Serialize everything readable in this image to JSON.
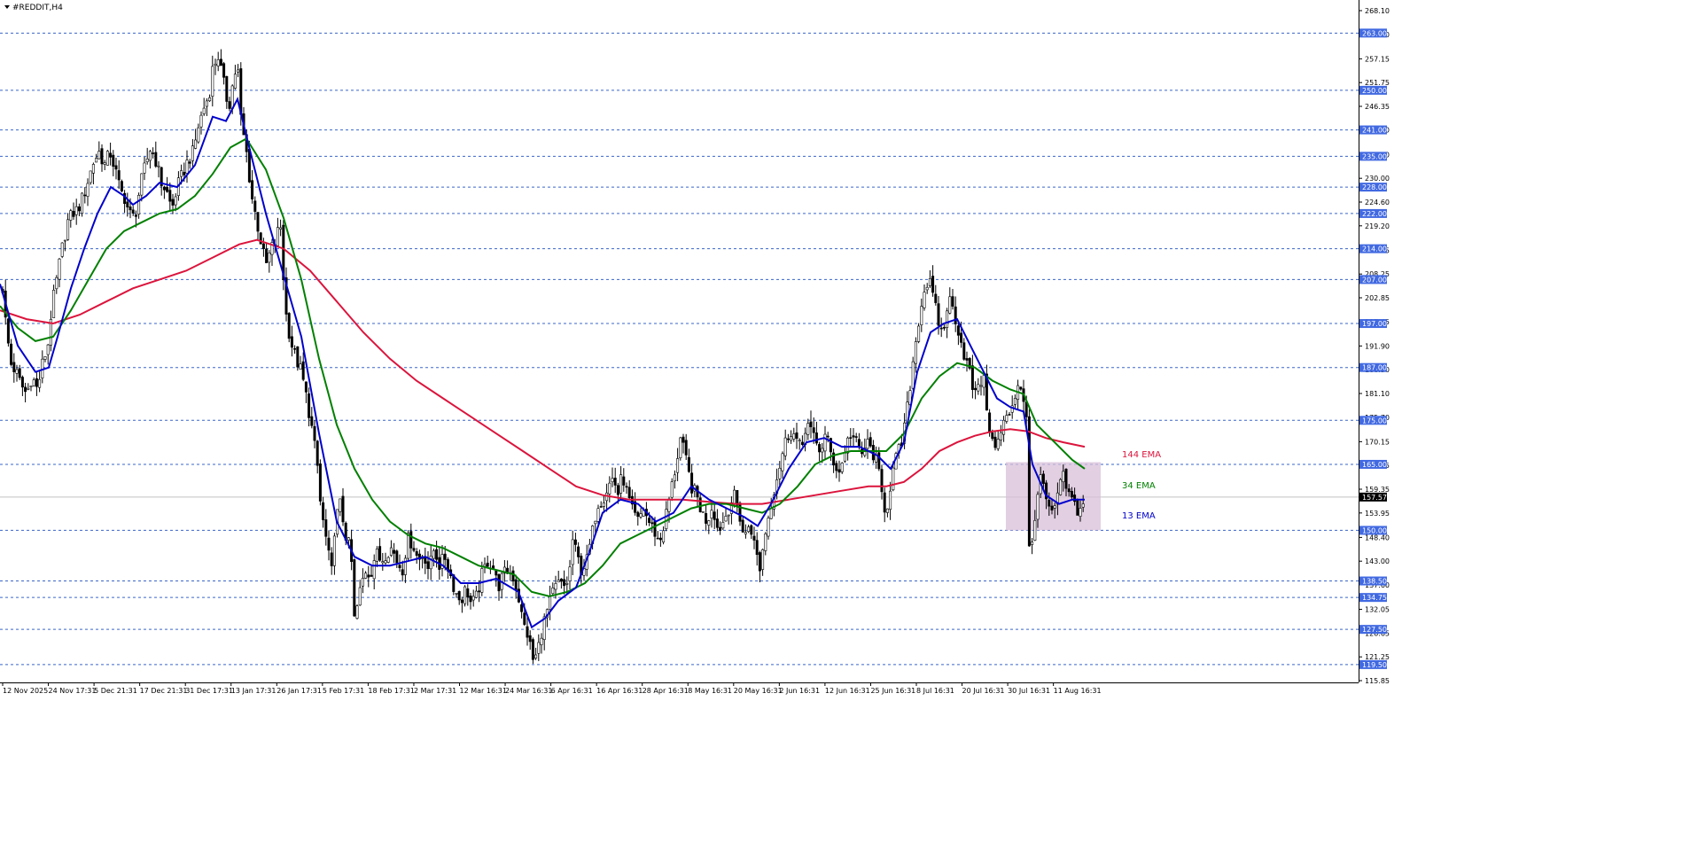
{
  "symbol_label": "#REDDIT,H4",
  "chart_data": {
    "type": "candlestick",
    "symbol": "#REDDIT",
    "timeframe": "H4",
    "last_price": 157.57,
    "y_axis_ticks": [
      268.1,
      262.7,
      257.15,
      251.75,
      246.35,
      241.0,
      235.4,
      230.0,
      224.6,
      219.2,
      213.65,
      208.25,
      202.85,
      197.45,
      191.9,
      186.5,
      181.1,
      175.7,
      170.15,
      164.75,
      159.35,
      153.95,
      148.4,
      143.0,
      137.6,
      132.05,
      126.65,
      121.25,
      115.85
    ],
    "y_axis_tick_labels": [
      "268.10",
      "262.70",
      "257.15",
      "251.75",
      "246.35",
      "241.00",
      "235.40",
      "230.00",
      "224.60",
      "219.20",
      "213.65",
      "208.25",
      "202.85",
      "197.45",
      "191.90",
      "186.50",
      "181.10",
      "175.70",
      "170.15",
      "164.75",
      "159.35",
      "153.95",
      "148.40",
      "143.00",
      "137.60",
      "132.05",
      "126.65",
      "121.25",
      "115.85"
    ],
    "level_lines": [
      263.0,
      250.0,
      241.0,
      235.0,
      228.0,
      222.0,
      214.0,
      207.0,
      197.0,
      187.0,
      175.0,
      165.0,
      150.0,
      138.5,
      134.75,
      127.5,
      119.5
    ],
    "level_line_labels": [
      "263.00",
      "250.00",
      "241.00",
      "235.00",
      "228.00",
      "222.00",
      "214.00",
      "207.00",
      "197.00",
      "187.00",
      "175.00",
      "165.00",
      "150.00",
      "138.50",
      "134.75",
      "127.50",
      "119.50"
    ],
    "x_axis_labels": [
      "12 Nov 2025",
      "24 Nov 17:31",
      "5 Dec 21:31",
      "17 Dec 21:31",
      "31 Dec 17:31",
      "13 Jan 17:31",
      "26 Jan 17:31",
      "5 Feb 17:31",
      "18 Feb 17:31",
      "2 Mar 17:31",
      "12 Mar 16:31",
      "24 Mar 16:31",
      "6 Apr 16:31",
      "16 Apr 16:31",
      "28 Apr 16:31",
      "8 May 16:31",
      "20 May 16:31",
      "2 Jun 16:31",
      "12 Jun 16:31",
      "25 Jun 16:31",
      "8 Jul 16:31",
      "20 Jul 16:31",
      "30 Jul 16:31",
      "11 Aug 16:31"
    ],
    "price_path": [
      [
        0,
        212
      ],
      [
        6,
        198
      ],
      [
        12,
        188
      ],
      [
        18,
        186
      ],
      [
        24,
        183
      ],
      [
        30,
        181
      ],
      [
        36,
        185
      ],
      [
        42,
        182
      ],
      [
        48,
        188
      ],
      [
        54,
        192
      ],
      [
        58,
        200
      ],
      [
        64,
        207
      ],
      [
        70,
        214
      ],
      [
        76,
        220
      ],
      [
        82,
        222
      ],
      [
        88,
        223
      ],
      [
        94,
        226
      ],
      [
        100,
        230
      ],
      [
        106,
        234
      ],
      [
        112,
        236
      ],
      [
        118,
        233
      ],
      [
        124,
        236
      ],
      [
        130,
        232
      ],
      [
        136,
        227
      ],
      [
        140,
        226
      ],
      [
        146,
        222
      ],
      [
        152,
        221
      ],
      [
        158,
        228
      ],
      [
        164,
        233
      ],
      [
        170,
        237
      ],
      [
        176,
        234
      ],
      [
        182,
        229
      ],
      [
        188,
        227
      ],
      [
        194,
        223
      ],
      [
        200,
        228
      ],
      [
        206,
        231
      ],
      [
        212,
        234
      ],
      [
        218,
        236
      ],
      [
        224,
        242
      ],
      [
        230,
        246
      ],
      [
        236,
        249
      ],
      [
        240,
        255
      ],
      [
        246,
        258
      ],
      [
        252,
        252
      ],
      [
        258,
        246
      ],
      [
        264,
        253
      ],
      [
        268,
        256
      ],
      [
        272,
        243
      ],
      [
        278,
        236
      ],
      [
        284,
        226
      ],
      [
        290,
        220
      ],
      [
        296,
        214
      ],
      [
        300,
        210
      ],
      [
        306,
        214
      ],
      [
        312,
        216
      ],
      [
        316,
        221
      ],
      [
        322,
        200
      ],
      [
        328,
        193
      ],
      [
        334,
        189
      ],
      [
        340,
        186
      ],
      [
        346,
        180
      ],
      [
        352,
        173
      ],
      [
        358,
        165
      ],
      [
        362,
        155
      ],
      [
        368,
        148
      ],
      [
        374,
        140
      ],
      [
        378,
        152
      ],
      [
        384,
        156
      ],
      [
        390,
        149
      ],
      [
        396,
        145
      ],
      [
        400,
        129
      ],
      [
        406,
        136
      ],
      [
        412,
        141
      ],
      [
        418,
        140
      ],
      [
        424,
        145
      ],
      [
        430,
        143
      ],
      [
        436,
        145
      ],
      [
        442,
        146
      ],
      [
        448,
        143
      ],
      [
        454,
        141
      ],
      [
        460,
        148
      ],
      [
        466,
        147
      ],
      [
        472,
        143
      ],
      [
        478,
        145
      ],
      [
        484,
        141
      ],
      [
        490,
        146
      ],
      [
        496,
        142
      ],
      [
        502,
        144
      ],
      [
        508,
        140
      ],
      [
        514,
        136
      ],
      [
        520,
        134
      ],
      [
        526,
        137
      ],
      [
        532,
        133
      ],
      [
        538,
        135
      ],
      [
        544,
        140
      ],
      [
        550,
        143
      ],
      [
        556,
        142
      ],
      [
        562,
        137
      ],
      [
        568,
        140
      ],
      [
        574,
        141
      ],
      [
        580,
        139
      ],
      [
        586,
        134
      ],
      [
        590,
        129
      ],
      [
        596,
        126
      ],
      [
        602,
        120
      ],
      [
        606,
        122
      ],
      [
        612,
        128
      ],
      [
        618,
        132
      ],
      [
        624,
        136
      ],
      [
        630,
        138
      ],
      [
        636,
        137
      ],
      [
        642,
        139
      ],
      [
        646,
        148
      ],
      [
        650,
        145
      ],
      [
        656,
        141
      ],
      [
        662,
        143
      ],
      [
        668,
        149
      ],
      [
        674,
        156
      ],
      [
        680,
        157
      ],
      [
        686,
        160
      ],
      [
        692,
        162
      ],
      [
        698,
        158
      ],
      [
        702,
        163
      ],
      [
        708,
        158
      ],
      [
        714,
        154
      ],
      [
        720,
        152
      ],
      [
        726,
        155
      ],
      [
        732,
        152
      ],
      [
        738,
        150
      ],
      [
        744,
        147
      ],
      [
        750,
        152
      ],
      [
        756,
        158
      ],
      [
        762,
        164
      ],
      [
        768,
        171
      ],
      [
        774,
        166
      ],
      [
        780,
        160
      ],
      [
        786,
        158
      ],
      [
        792,
        154
      ],
      [
        798,
        152
      ],
      [
        804,
        156
      ],
      [
        810,
        150
      ],
      [
        816,
        152
      ],
      [
        822,
        155
      ],
      [
        828,
        158
      ],
      [
        834,
        154
      ],
      [
        840,
        148
      ],
      [
        846,
        152
      ],
      [
        852,
        146
      ],
      [
        858,
        141
      ],
      [
        862,
        148
      ],
      [
        868,
        154
      ],
      [
        874,
        160
      ],
      [
        880,
        165
      ],
      [
        886,
        170
      ],
      [
        892,
        173
      ],
      [
        898,
        171
      ],
      [
        904,
        168
      ],
      [
        910,
        175
      ],
      [
        916,
        172
      ],
      [
        920,
        170
      ],
      [
        926,
        168
      ],
      [
        932,
        172
      ],
      [
        938,
        167
      ],
      [
        942,
        165
      ],
      [
        948,
        163
      ],
      [
        954,
        169
      ],
      [
        960,
        172
      ],
      [
        966,
        170
      ],
      [
        972,
        167
      ],
      [
        978,
        170
      ],
      [
        984,
        168
      ],
      [
        990,
        165
      ],
      [
        996,
        157
      ],
      [
        1000,
        154
      ],
      [
        1006,
        162
      ],
      [
        1012,
        167
      ],
      [
        1018,
        170
      ],
      [
        1024,
        178
      ],
      [
        1030,
        188
      ],
      [
        1036,
        197
      ],
      [
        1042,
        204
      ],
      [
        1048,
        207
      ],
      [
        1054,
        202
      ],
      [
        1058,
        198
      ],
      [
        1064,
        194
      ],
      [
        1070,
        203
      ],
      [
        1076,
        200
      ],
      [
        1082,
        195
      ],
      [
        1088,
        190
      ],
      [
        1094,
        186
      ],
      [
        1100,
        180
      ],
      [
        1104,
        184
      ],
      [
        1110,
        184
      ],
      [
        1116,
        174
      ],
      [
        1122,
        168
      ],
      [
        1126,
        170
      ],
      [
        1132,
        174
      ],
      [
        1138,
        176
      ],
      [
        1144,
        180
      ],
      [
        1150,
        184
      ],
      [
        1154,
        181
      ],
      [
        1158,
        177
      ],
      [
        1162,
        140
      ],
      [
        1166,
        151
      ],
      [
        1172,
        160
      ],
      [
        1176,
        162
      ],
      [
        1182,
        155
      ],
      [
        1188,
        153
      ],
      [
        1194,
        159
      ],
      [
        1200,
        162
      ],
      [
        1206,
        158
      ],
      [
        1212,
        156
      ],
      [
        1218,
        154
      ],
      [
        1224,
        157.57
      ]
    ],
    "ema_13_path": [
      [
        0,
        206
      ],
      [
        20,
        192
      ],
      [
        40,
        186
      ],
      [
        55,
        187
      ],
      [
        65,
        194
      ],
      [
        80,
        205
      ],
      [
        95,
        214
      ],
      [
        110,
        222
      ],
      [
        125,
        228
      ],
      [
        140,
        226
      ],
      [
        150,
        224
      ],
      [
        165,
        226
      ],
      [
        180,
        229
      ],
      [
        200,
        228
      ],
      [
        220,
        233
      ],
      [
        240,
        244
      ],
      [
        255,
        243
      ],
      [
        268,
        248
      ],
      [
        280,
        238
      ],
      [
        300,
        222
      ],
      [
        320,
        208
      ],
      [
        340,
        194
      ],
      [
        360,
        172
      ],
      [
        380,
        152
      ],
      [
        400,
        144
      ],
      [
        420,
        142
      ],
      [
        440,
        142
      ],
      [
        460,
        143
      ],
      [
        480,
        144
      ],
      [
        500,
        142
      ],
      [
        520,
        138
      ],
      [
        540,
        138
      ],
      [
        560,
        139
      ],
      [
        585,
        136
      ],
      [
        600,
        128
      ],
      [
        615,
        130
      ],
      [
        630,
        134
      ],
      [
        650,
        137
      ],
      [
        665,
        145
      ],
      [
        680,
        154
      ],
      [
        700,
        157
      ],
      [
        720,
        156
      ],
      [
        740,
        152
      ],
      [
        760,
        154
      ],
      [
        780,
        160
      ],
      [
        800,
        157
      ],
      [
        820,
        155
      ],
      [
        840,
        153
      ],
      [
        855,
        151
      ],
      [
        870,
        156
      ],
      [
        890,
        164
      ],
      [
        910,
        170
      ],
      [
        930,
        171
      ],
      [
        950,
        169
      ],
      [
        970,
        169
      ],
      [
        990,
        167
      ],
      [
        1005,
        164
      ],
      [
        1020,
        170
      ],
      [
        1035,
        186
      ],
      [
        1050,
        195
      ],
      [
        1065,
        197
      ],
      [
        1080,
        198
      ],
      [
        1095,
        192
      ],
      [
        1110,
        186
      ],
      [
        1125,
        180
      ],
      [
        1140,
        178
      ],
      [
        1155,
        177
      ],
      [
        1165,
        165
      ],
      [
        1180,
        158
      ],
      [
        1195,
        156
      ],
      [
        1210,
        157
      ],
      [
        1224,
        157
      ]
    ],
    "ema_34_path": [
      [
        0,
        201
      ],
      [
        20,
        196
      ],
      [
        40,
        193
      ],
      [
        60,
        194
      ],
      [
        80,
        200
      ],
      [
        100,
        207
      ],
      [
        120,
        214
      ],
      [
        140,
        218
      ],
      [
        160,
        220
      ],
      [
        180,
        222
      ],
      [
        200,
        223
      ],
      [
        220,
        226
      ],
      [
        240,
        231
      ],
      [
        260,
        237
      ],
      [
        278,
        239
      ],
      [
        300,
        232
      ],
      [
        320,
        221
      ],
      [
        340,
        207
      ],
      [
        360,
        189
      ],
      [
        380,
        174
      ],
      [
        400,
        164
      ],
      [
        420,
        157
      ],
      [
        440,
        152
      ],
      [
        460,
        149
      ],
      [
        480,
        147
      ],
      [
        500,
        146
      ],
      [
        520,
        144
      ],
      [
        540,
        142
      ],
      [
        560,
        141
      ],
      [
        580,
        140
      ],
      [
        600,
        136
      ],
      [
        620,
        135
      ],
      [
        640,
        136
      ],
      [
        660,
        138
      ],
      [
        680,
        142
      ],
      [
        700,
        147
      ],
      [
        720,
        149
      ],
      [
        740,
        151
      ],
      [
        760,
        153
      ],
      [
        780,
        155
      ],
      [
        800,
        156
      ],
      [
        820,
        156
      ],
      [
        840,
        155
      ],
      [
        860,
        154
      ],
      [
        880,
        156
      ],
      [
        900,
        160
      ],
      [
        920,
        165
      ],
      [
        940,
        167
      ],
      [
        960,
        168
      ],
      [
        980,
        168
      ],
      [
        1000,
        168
      ],
      [
        1020,
        172
      ],
      [
        1040,
        180
      ],
      [
        1060,
        185
      ],
      [
        1080,
        188
      ],
      [
        1100,
        187
      ],
      [
        1120,
        184
      ],
      [
        1140,
        182
      ],
      [
        1155,
        181
      ],
      [
        1170,
        174
      ],
      [
        1190,
        170
      ],
      [
        1210,
        166
      ],
      [
        1224,
        164
      ]
    ],
    "ema_144_path": [
      [
        0,
        200
      ],
      [
        30,
        198
      ],
      [
        60,
        197
      ],
      [
        90,
        199
      ],
      [
        120,
        202
      ],
      [
        150,
        205
      ],
      [
        180,
        207
      ],
      [
        210,
        209
      ],
      [
        240,
        212
      ],
      [
        270,
        215
      ],
      [
        290,
        216
      ],
      [
        320,
        214
      ],
      [
        350,
        209
      ],
      [
        380,
        202
      ],
      [
        410,
        195
      ],
      [
        440,
        189
      ],
      [
        470,
        184
      ],
      [
        500,
        180
      ],
      [
        530,
        176
      ],
      [
        560,
        172
      ],
      [
        590,
        168
      ],
      [
        620,
        164
      ],
      [
        650,
        160
      ],
      [
        680,
        158
      ],
      [
        710,
        157
      ],
      [
        740,
        157
      ],
      [
        770,
        157
      ],
      [
        800,
        156.5
      ],
      [
        830,
        156
      ],
      [
        860,
        156
      ],
      [
        890,
        157
      ],
      [
        920,
        158
      ],
      [
        950,
        159
      ],
      [
        980,
        160
      ],
      [
        1000,
        160
      ],
      [
        1020,
        161
      ],
      [
        1040,
        164
      ],
      [
        1060,
        168
      ],
      [
        1080,
        170
      ],
      [
        1100,
        171.5
      ],
      [
        1120,
        172.5
      ],
      [
        1140,
        173
      ],
      [
        1160,
        172.5
      ],
      [
        1180,
        171
      ],
      [
        1200,
        170
      ],
      [
        1224,
        169
      ]
    ],
    "series": [
      {
        "name": "144 EMA",
        "color": "#dc143c"
      },
      {
        "name": "34 EMA",
        "color": "#008000"
      },
      {
        "name": "13 EMA",
        "color": "#0000cd"
      }
    ],
    "highlight_box": {
      "price_top": 165.5,
      "price_bottom": 150.0,
      "color": "#d8bfd8"
    },
    "colors": {
      "candle": "#000000",
      "grid_level": "#3a66c9",
      "level_label_bg": "#4169e1",
      "last_price_bg": "#000000",
      "last_price_line": "#c0c0c0"
    }
  }
}
